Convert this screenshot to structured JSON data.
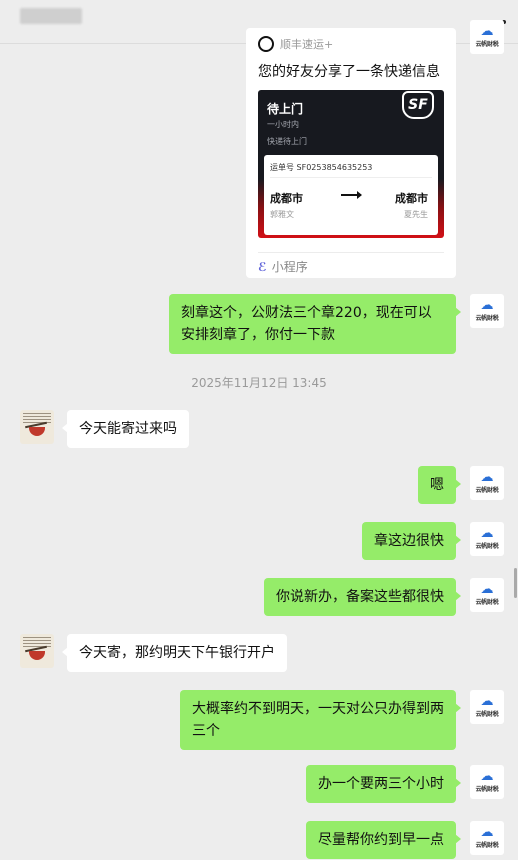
{
  "header": {
    "menu_icon": "more-dots-icon"
  },
  "card": {
    "top_label": "顺丰速运+",
    "desc": "您的好友分享了一条快递信息",
    "status_title": "待上门",
    "status_line1": "一小时内",
    "status_line2": "快递待上门",
    "logo": "SF",
    "waybill": "运单号 SF0253854635253",
    "from_city": "成都市",
    "from_name": "郭雅文",
    "to_city": "成都市",
    "to_name": "夏先生",
    "footer": "小程序"
  },
  "avatars": {
    "right_label": "云帆财税",
    "right_icon": "cloud-icon"
  },
  "timestamp": "2025年11月12日 13:45",
  "messages": [
    {
      "text": "刻章这个，公财法三个章220，现在可以安排刻章了，你付一下款"
    },
    {
      "text": "今天能寄过来吗"
    },
    {
      "text": "嗯"
    },
    {
      "text": "章这边很快"
    },
    {
      "text": "你说新办，备案这些都很快"
    },
    {
      "text": "今天寄，那约明天下午银行开户"
    },
    {
      "text": "大概率约不到明天，一天对公只办得到两三个"
    },
    {
      "text": "办一个要两三个小时"
    },
    {
      "text": "尽量帮你约到早一点"
    }
  ]
}
